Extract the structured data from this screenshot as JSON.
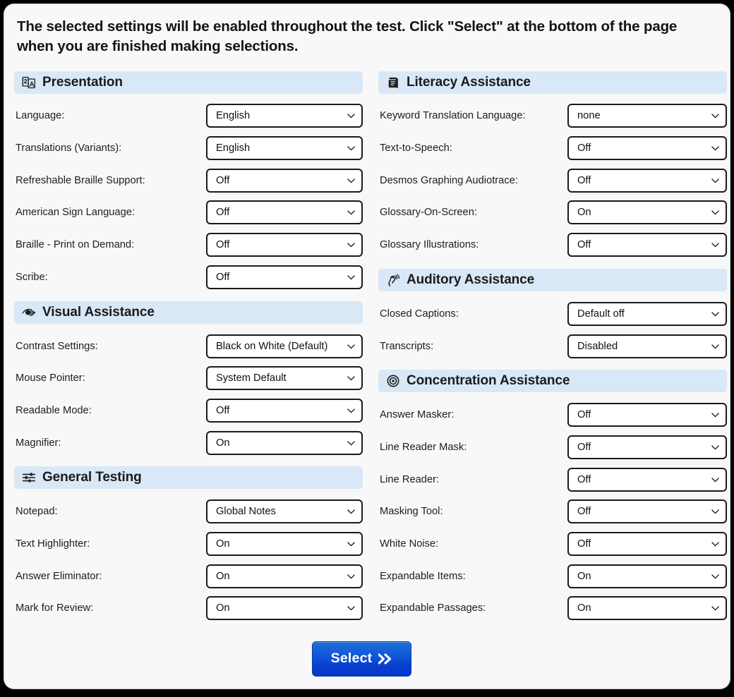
{
  "intro": {
    "text": "The selected settings will be enabled throughout the test. Click \"Select\" at the bottom of the page when you are finished making selections."
  },
  "colors": {
    "section_header_bg": "#d9e8f6",
    "page_bg": "#f8f8f8",
    "button_blue": "#1057d8",
    "select_border": "#1a1a1a"
  },
  "left_column": {
    "sections": [
      {
        "title": "Presentation",
        "icon": "translate-icon",
        "settings": [
          {
            "label": "Language:",
            "value": "English"
          },
          {
            "label": "Translations (Variants):",
            "value": "English"
          },
          {
            "label": "Refreshable Braille Support:",
            "value": "Off"
          },
          {
            "label": "American Sign Language:",
            "value": "Off"
          },
          {
            "label": "Braille - Print on Demand:",
            "value": "Off"
          },
          {
            "label": "Scribe:",
            "value": "Off"
          }
        ]
      },
      {
        "title": "Visual Assistance",
        "icon": "low-vision-icon",
        "settings": [
          {
            "label": "Contrast Settings:",
            "value": "Black on White (Default)"
          },
          {
            "label": "Mouse Pointer:",
            "value": "System Default"
          },
          {
            "label": "Readable Mode:",
            "value": "Off"
          },
          {
            "label": "Magnifier:",
            "value": "On"
          }
        ]
      },
      {
        "title": "General Testing",
        "icon": "sliders-icon",
        "settings": [
          {
            "label": "Notepad:",
            "value": "Global Notes"
          },
          {
            "label": "Text Highlighter:",
            "value": "On"
          },
          {
            "label": "Answer Eliminator:",
            "value": "On"
          },
          {
            "label": "Mark for Review:",
            "value": "On"
          }
        ]
      }
    ]
  },
  "right_column": {
    "sections": [
      {
        "title": "Literacy Assistance",
        "icon": "book-icon",
        "settings": [
          {
            "label": "Keyword Translation Language:",
            "value": "none"
          },
          {
            "label": "Text-to-Speech:",
            "value": "Off"
          },
          {
            "label": "Desmos Graphing Audiotrace:",
            "value": "Off"
          },
          {
            "label": "Glossary-On-Screen:",
            "value": "On"
          },
          {
            "label": "Glossary Illustrations:",
            "value": "Off"
          }
        ]
      },
      {
        "title": "Auditory Assistance",
        "icon": "ear-hearing-icon",
        "settings": [
          {
            "label": "Closed Captions:",
            "value": "Default off"
          },
          {
            "label": "Transcripts:",
            "value": "Disabled"
          }
        ]
      },
      {
        "title": "Concentration Assistance",
        "icon": "target-icon",
        "settings": [
          {
            "label": "Answer Masker:",
            "value": "Off"
          },
          {
            "label": "Line Reader Mask:",
            "value": "Off"
          },
          {
            "label": "Line Reader:",
            "value": "Off"
          },
          {
            "label": "Masking Tool:",
            "value": "Off"
          },
          {
            "label": "White Noise:",
            "value": "Off"
          },
          {
            "label": "Expandable Items:",
            "value": "On"
          },
          {
            "label": "Expandable Passages:",
            "value": "On"
          }
        ]
      }
    ]
  },
  "footer": {
    "select_label": "Select",
    "select_icon": "double-chevron-right-icon"
  }
}
